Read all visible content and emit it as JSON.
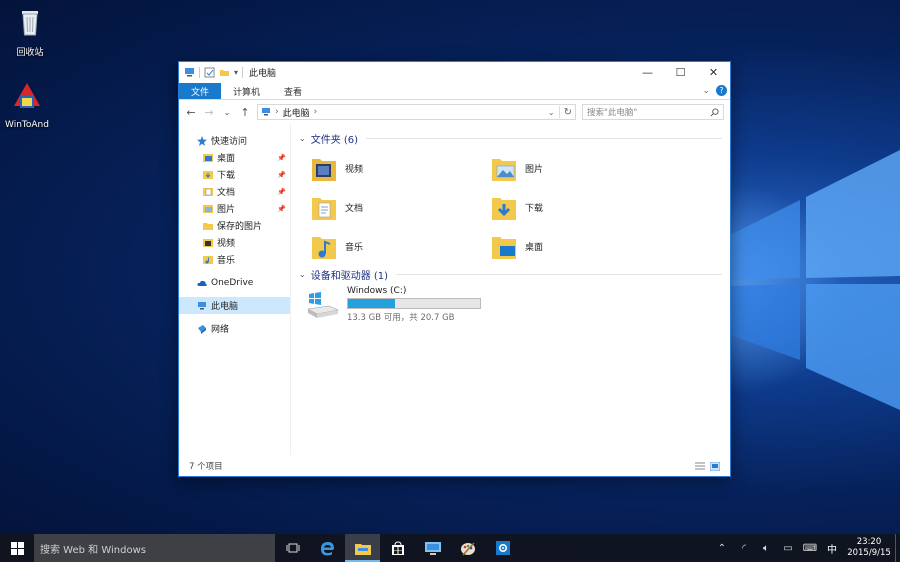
{
  "desktop": {
    "icons": [
      {
        "label": "回收站",
        "icon": "recycle-bin-icon"
      },
      {
        "label": "WinToAnd",
        "icon": "wintoand-app-icon"
      }
    ]
  },
  "window": {
    "title": "此电脑",
    "controls": {
      "minimize": "—",
      "maximize": "☐",
      "close": "✕"
    }
  },
  "ribbon": {
    "tabs": [
      {
        "label": "文件",
        "active": true
      },
      {
        "label": "计算机",
        "active": false
      },
      {
        "label": "查看",
        "active": false
      }
    ],
    "help": "?"
  },
  "nav": {
    "back": "←",
    "forward": "→",
    "recent": "⌄",
    "up": "↑",
    "address_path": "此电脑",
    "address_sep": "›",
    "search_placeholder": "搜索\"此电脑\""
  },
  "sidebar": {
    "quick_access": "快速访问",
    "quick_items": [
      {
        "label": "桌面",
        "pinned": true
      },
      {
        "label": "下载",
        "pinned": true
      },
      {
        "label": "文档",
        "pinned": true
      },
      {
        "label": "图片",
        "pinned": true
      },
      {
        "label": "保存的图片",
        "pinned": false
      },
      {
        "label": "视频",
        "pinned": false
      },
      {
        "label": "音乐",
        "pinned": false
      }
    ],
    "onedrive": "OneDrive",
    "this_pc": "此电脑",
    "network": "网络"
  },
  "content": {
    "folders_header": "文件夹 (6)",
    "folders": [
      {
        "label": "视频",
        "icon": "video-folder-icon"
      },
      {
        "label": "图片",
        "icon": "pictures-folder-icon"
      },
      {
        "label": "文档",
        "icon": "documents-folder-icon"
      },
      {
        "label": "下载",
        "icon": "downloads-folder-icon"
      },
      {
        "label": "音乐",
        "icon": "music-folder-icon"
      },
      {
        "label": "桌面",
        "icon": "desktop-folder-icon"
      }
    ],
    "devices_header": "设备和驱动器 (1)",
    "drive": {
      "name": "Windows (C:)",
      "used_fraction": 0.357,
      "detail": "13.3 GB 可用，共 20.7 GB"
    }
  },
  "statusbar": {
    "count": "7 个项目"
  },
  "taskbar": {
    "search_placeholder": "搜索 Web 和 Windows",
    "ime": "中",
    "time": "23:20",
    "date": "2015/9/15"
  },
  "colors": {
    "accent": "#1979ca",
    "folder": "#f2c94c",
    "drive_fill": "#26a0da"
  }
}
